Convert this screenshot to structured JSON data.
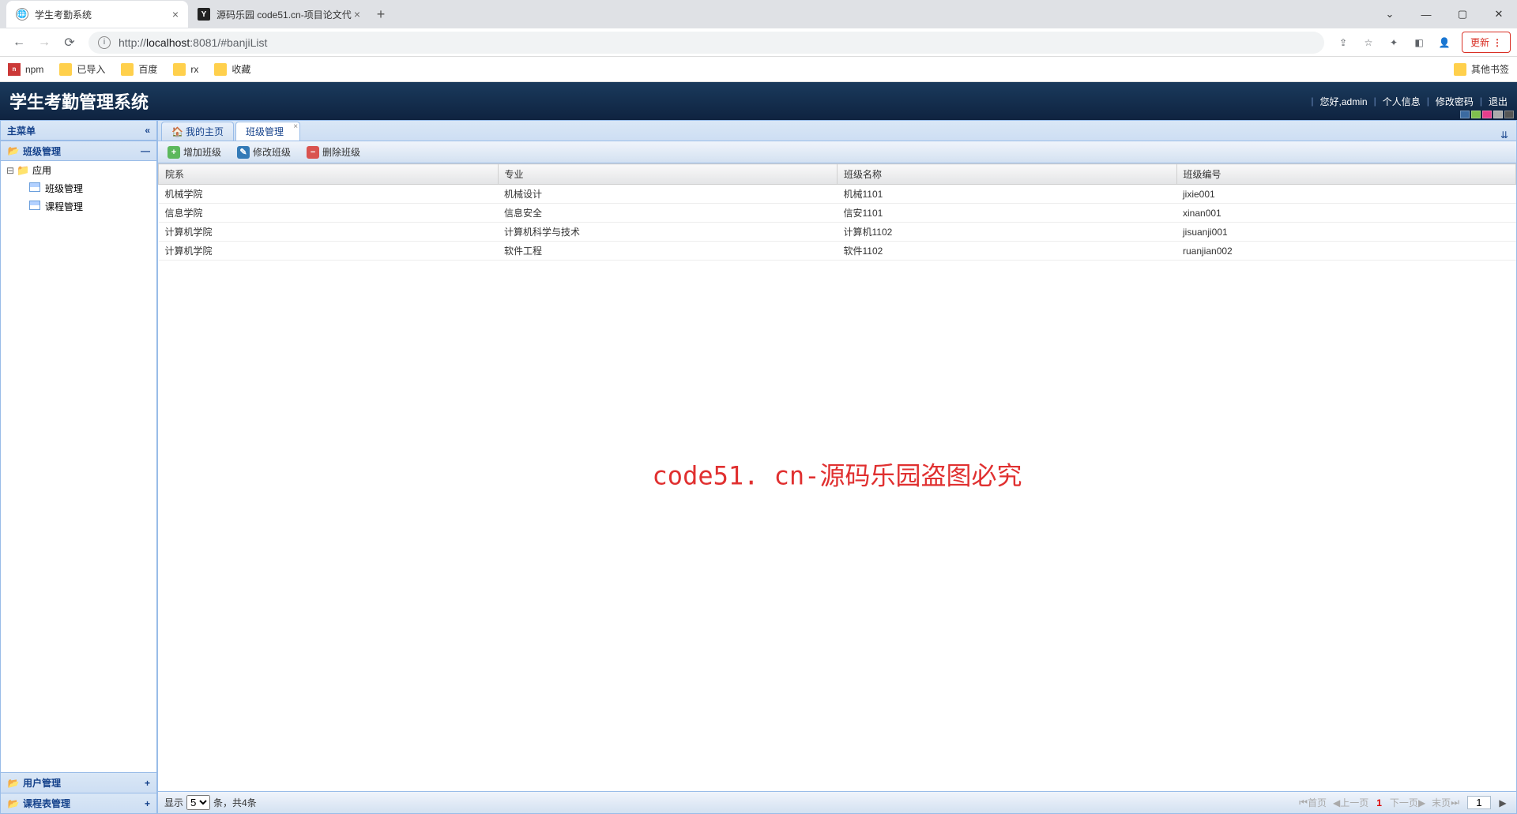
{
  "browser": {
    "tabs": [
      {
        "title": "学生考勤系统",
        "active": true
      },
      {
        "title": "源码乐园 code51.cn-项目论文代",
        "active": false
      }
    ],
    "url_prefix": "http://",
    "url_host": "localhost",
    "url_port": ":8081",
    "url_path": "/#banjiList",
    "update_label": "更新",
    "bookmarks": [
      "npm",
      "已导入",
      "百度",
      "rx",
      "收藏"
    ],
    "other_bookmarks": "其他书签"
  },
  "header": {
    "title": "学生考勤管理系统",
    "greeting": "您好,admin",
    "links": [
      "个人信息",
      "修改密码",
      "退出"
    ],
    "theme_colors": [
      "#3b6aa0",
      "#7fbf4d",
      "#e83e8c",
      "#aaaaaa",
      "#555555"
    ]
  },
  "sidebar": {
    "title": "主菜单",
    "panels": [
      {
        "label": "班级管理",
        "expanded": true,
        "tree": {
          "root": "应用",
          "children": [
            "班级管理",
            "课程管理"
          ]
        }
      },
      {
        "label": "用户管理",
        "expanded": false
      },
      {
        "label": "课程表管理",
        "expanded": false
      }
    ]
  },
  "tabs": {
    "items": [
      {
        "label": "我的主页",
        "closable": false
      },
      {
        "label": "班级管理",
        "closable": true,
        "active": true
      }
    ]
  },
  "toolbar": {
    "add": "增加班级",
    "edit": "修改班级",
    "del": "删除班级"
  },
  "grid": {
    "columns": [
      "院系",
      "专业",
      "班级名称",
      "班级编号"
    ],
    "rows": [
      [
        "机械学院",
        "机械设计",
        "机械1101",
        "jixie001"
      ],
      [
        "信息学院",
        "信息安全",
        "信安1101",
        "xinan001"
      ],
      [
        "计算机学院",
        "计算机科学与技术",
        "计算机1102",
        "jisuanji001"
      ],
      [
        "计算机学院",
        "软件工程",
        "软件1102",
        "ruanjian002"
      ]
    ]
  },
  "pager": {
    "show_label": "显示",
    "page_size": "5",
    "unit_label": "条，共4条",
    "first": "首页",
    "prev": "上一页",
    "current": "1",
    "next": "下一页",
    "last": "末页",
    "page_input": "1"
  },
  "watermark": "code51. cn-源码乐园盗图必究"
}
